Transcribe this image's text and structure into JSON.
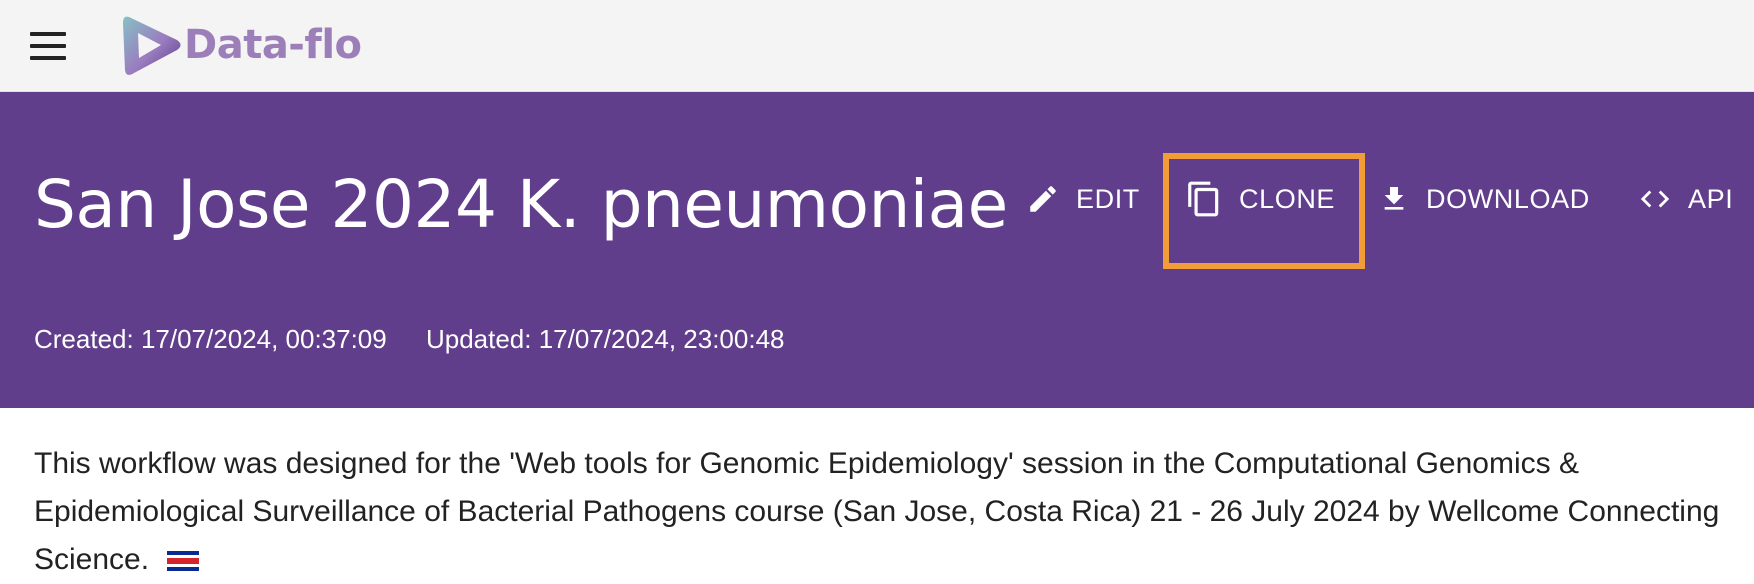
{
  "app": {
    "name": "Data-flo",
    "brand_color": "#9c7fb8",
    "header_color": "#613e8c",
    "highlight_color": "#f29d38"
  },
  "topbar": {
    "menu_icon": "hamburger-menu-icon",
    "logo_icon": "play-triangle-logo-icon"
  },
  "workflow": {
    "title": "San Jose 2024 K. pneumoniae",
    "created": "Created: 17/07/2024, 00:37:09",
    "updated": "Updated: 17/07/2024, 23:00:48",
    "description": "This workflow was designed for the 'Web tools for Genomic Epidemiology' session in the Computational Genomics & Epidemiological Surveillance of Bacterial Pathogens course (San Jose, Costa Rica) 21 - 26 July 2024 by Wellcome Connecting Science.",
    "description_icon": "costa-rica-flag-icon"
  },
  "actions": {
    "edit": {
      "label": "EDIT",
      "icon": "pencil-icon"
    },
    "clone": {
      "label": "CLONE",
      "icon": "copy-icon"
    },
    "download": {
      "label": "DOWNLOAD",
      "icon": "download-icon"
    },
    "api": {
      "label": "API",
      "icon": "code-brackets-icon"
    }
  }
}
